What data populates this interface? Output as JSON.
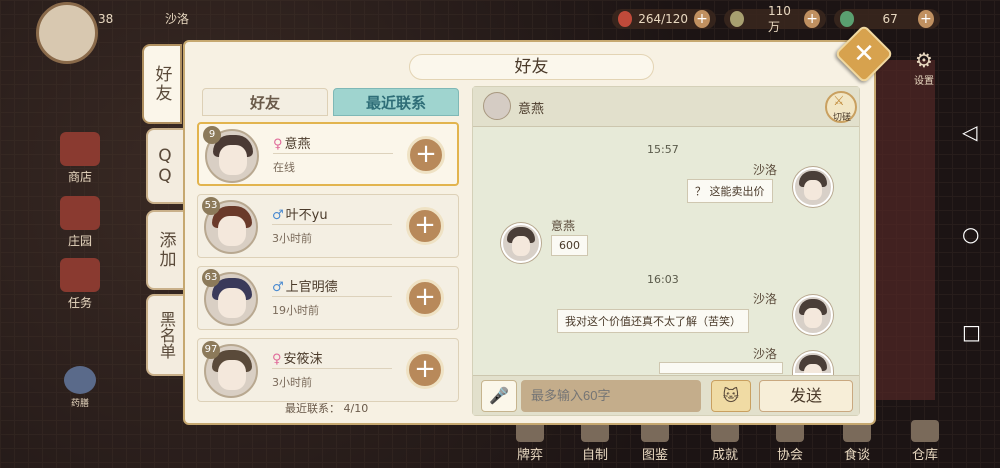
{
  "hud": {
    "level": "38",
    "name": "沙洛",
    "resources": [
      {
        "icon": "meat-icon",
        "value": "264/120"
      },
      {
        "icon": "leaf-icon",
        "value": "110万"
      },
      {
        "icon": "coin-icon",
        "value": "67"
      }
    ],
    "settings_label": "设置"
  },
  "left_menu": [
    "商店",
    "庄园",
    "任务",
    "药膳"
  ],
  "bottom_menu": [
    "牌弈",
    "自制",
    "图鉴",
    "成就",
    "协会",
    "食谈",
    "仓库"
  ],
  "dialog": {
    "title": "好友",
    "side_tabs": [
      "好友",
      "QQ",
      "添加",
      "黑名单"
    ],
    "list_tabs": {
      "friends": "好友",
      "recent": "最近联系"
    },
    "contacts": [
      {
        "level": "9",
        "gender": "♀",
        "name": "意燕",
        "status": "在线"
      },
      {
        "level": "53",
        "gender": "♂",
        "name": "叶不yu",
        "status": "3小时前"
      },
      {
        "level": "63",
        "gender": "♂",
        "name": "上官明德",
        "status": "19小时前"
      },
      {
        "level": "97",
        "gender": "♀",
        "name": "安筱沫",
        "status": "3小时前"
      }
    ],
    "recent_count_label": "最近联系：",
    "recent_count": "4/10"
  },
  "chat": {
    "partner_name": "意燕",
    "switch_label": "切磋",
    "messages": [
      {
        "time": "15:57"
      },
      {
        "sender": "沙洛",
        "text": "？ 这能卖出价"
      },
      {
        "sender": "意燕",
        "text": "600"
      },
      {
        "time": "16:03"
      },
      {
        "sender": "沙洛",
        "text": "我对这个价值还真不太了解（苦笑）"
      },
      {
        "sender": "沙洛",
        "text": ""
      }
    ],
    "input_placeholder": "最多输入60字",
    "send_label": "发送"
  },
  "colors": {
    "accent": "#d7a24e",
    "tab_active": "#9fd4cf",
    "panel": "#f7f1e3"
  }
}
